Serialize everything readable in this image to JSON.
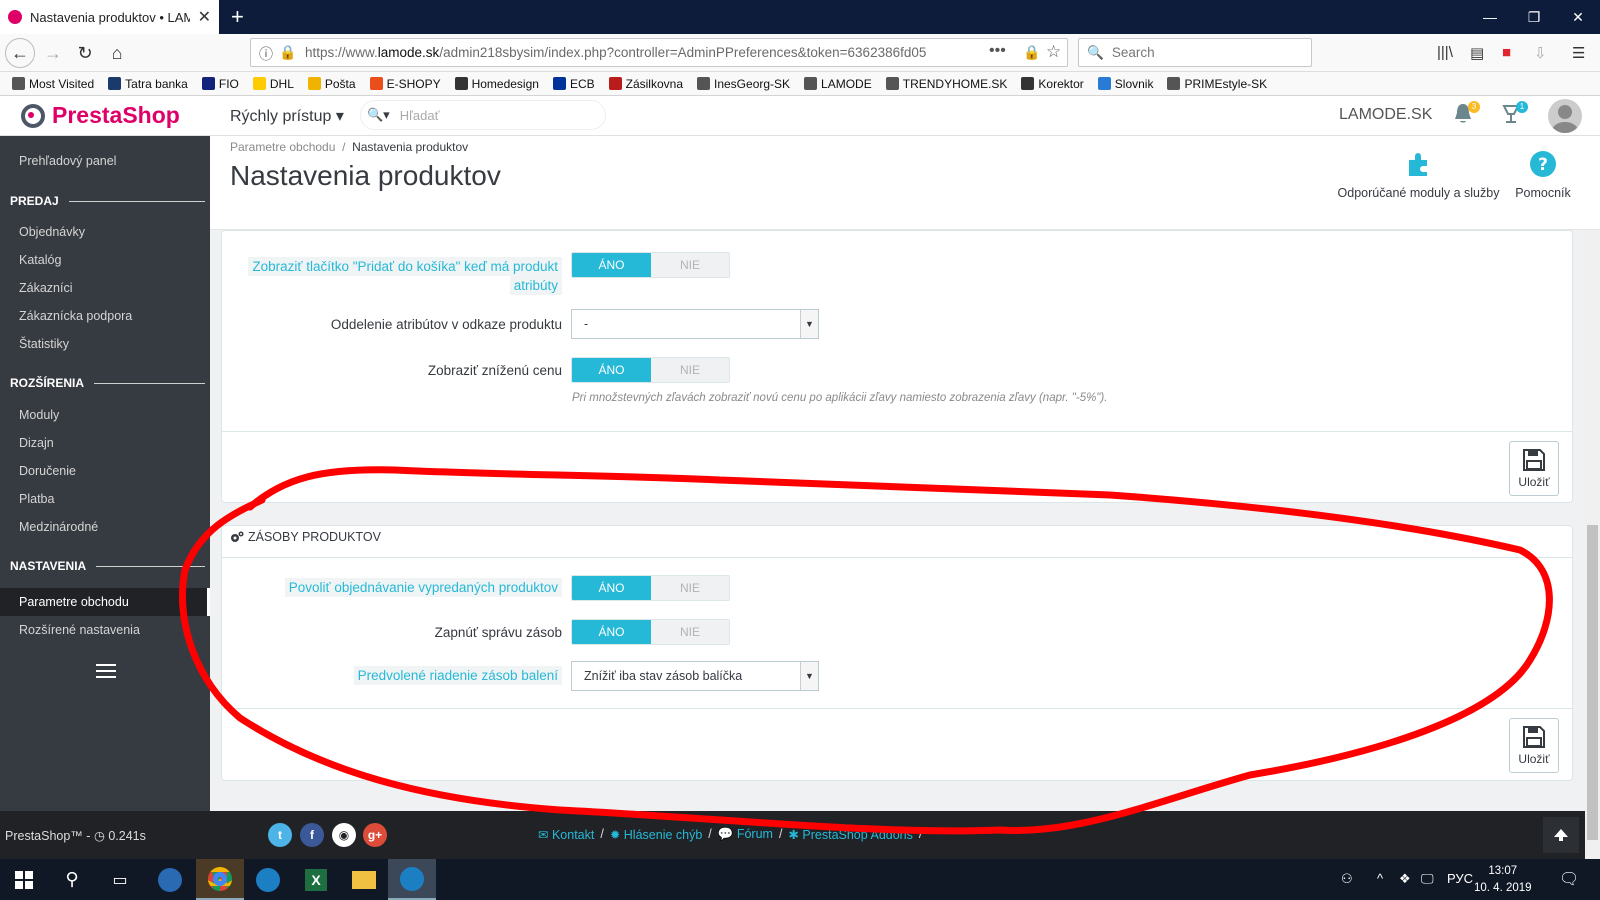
{
  "browser": {
    "tab_title": "Nastavenia produktov • LAMODE",
    "url_prefix": "https://www.",
    "url_domain": "lamode.sk",
    "url_rest": "/admin218sbysim/index.php?controller=AdminPPreferences&token=6362386fd05",
    "search_placeholder": "Search"
  },
  "bookmarks": [
    {
      "label": "Most Visited",
      "icon": "gear-icon",
      "color": "#555555"
    },
    {
      "label": "Tatra banka",
      "icon": "bank-icon",
      "color": "#1a3a6b"
    },
    {
      "label": "FIO",
      "icon": "fio-icon",
      "color": "#13227a"
    },
    {
      "label": "DHL",
      "icon": "dhl-icon",
      "color": "#ffcc00"
    },
    {
      "label": "Pošta",
      "icon": "post-icon",
      "color": "#f0b400"
    },
    {
      "label": "E-SHOPY",
      "icon": "shop-icon",
      "color": "#e94e1b"
    },
    {
      "label": "Homedesign",
      "icon": "globe-icon",
      "color": "#333333"
    },
    {
      "label": "ECB",
      "icon": "ecb-icon",
      "color": "#003399"
    },
    {
      "label": "Zásilkovna",
      "icon": "package-icon",
      "color": "#ba1b1b"
    },
    {
      "label": "InesGeorg-SK",
      "icon": "prestashop-icon",
      "color": "#555555"
    },
    {
      "label": "LAMODE",
      "icon": "prestashop-icon",
      "color": "#555555"
    },
    {
      "label": "TRENDYHOME.SK",
      "icon": "prestashop-icon",
      "color": "#555555"
    },
    {
      "label": "Korektor",
      "icon": "check-icon",
      "color": "#333333"
    },
    {
      "label": "Slovnik",
      "icon": "s-icon",
      "color": "#2a7bd6"
    },
    {
      "label": "PRIMEstyle-SK",
      "icon": "prestashop-icon",
      "color": "#555555"
    }
  ],
  "header": {
    "logo_presta": "Presta",
    "logo_shop": "Shop",
    "quick_access": "Rýchly prístup",
    "search_placeholder": "Hľadať",
    "shop_name": "LAMODE.SK",
    "notif_count": "3",
    "orders_count": "1"
  },
  "sidebar": {
    "dashboard": "Prehľadový panel",
    "sec_sales": "PREDAJ",
    "orders": "Objednávky",
    "catalog": "Katalóg",
    "customers": "Zákazníci",
    "support": "Zákaznícka podpora",
    "stats": "Štatistiky",
    "sec_ext": "ROZŠÍRENIA",
    "modules": "Moduly",
    "design": "Dizajn",
    "shipping": "Doručenie",
    "payment": "Platba",
    "intl": "Medzinárodné",
    "sec_settings": "NASTAVENIA",
    "shop_params": "Parametre obchodu",
    "advanced": "Rozšírené nastavenia"
  },
  "page": {
    "crumb_parent": "Parametre obchodu",
    "crumb_sep": "/",
    "crumb_current": "Nastavenia produktov",
    "title": "Nastavenia produktov",
    "action_modules": "Odporúčané moduly a služby",
    "action_help": "Pomocník"
  },
  "panel1": {
    "row1_label_a": "Zobraziť tlačítko \"Pridať do košíka\" keď má produkt",
    "row1_label_b": "atribúty",
    "row2_label": "Oddelenie atribútov v odkaze produktu",
    "row2_value": "-",
    "row3_label": "Zobraziť zníženú cenu",
    "row3_hint": "Pri množstevných zľavách zobraziť novú cenu po aplikácii zľavy namiesto zobrazenia zľavy (napr. \"-5%\").",
    "save": "Uložiť"
  },
  "panel2": {
    "title": "ZÁSOBY PRODUKTOV",
    "row1_label": "Povoliť objednávanie vypredaných produktov",
    "row2_label": "Zapnúť správu zásob",
    "row3_label": "Predvolené riadenie zásob balení",
    "row3_value": "Znížiť iba stav zásob balíčka",
    "save": "Uložiť"
  },
  "switch": {
    "yes": "ÁNO",
    "no": "NIE"
  },
  "footer": {
    "version": "PrestaShop™ - ",
    "time": "0.241s",
    "link_contact": "Kontakt",
    "link_bugs": "Hlásenie chýb",
    "link_forum": "Fórum",
    "link_addons": "PrestaShop Addons",
    "sep": "/"
  },
  "taskbar": {
    "lang": "РУС",
    "time": "13:07",
    "date": "10. 4. 2019"
  },
  "colors": {
    "accent": "#25b9d7",
    "annotation": "#ff0000",
    "sidebar": "#363a41"
  }
}
